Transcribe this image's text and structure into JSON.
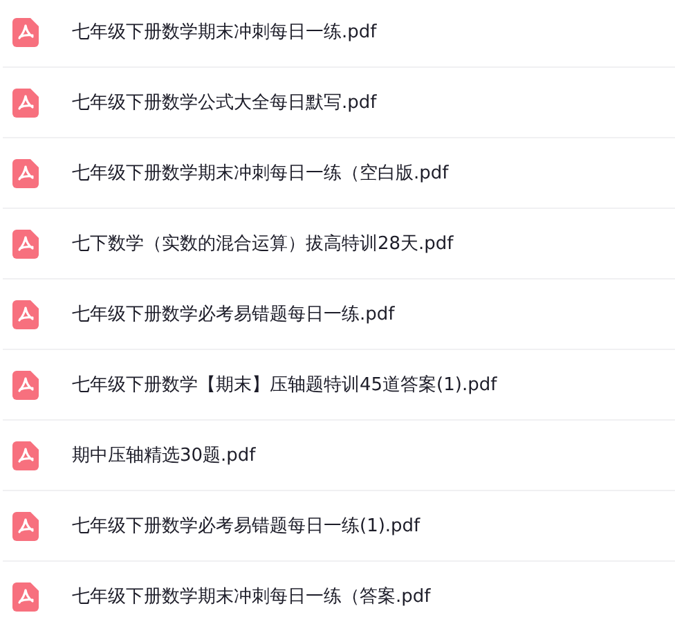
{
  "files": [
    {
      "name": "七年级下册数学期末冲刺每日一练.pdf"
    },
    {
      "name": "七年级下册数学公式大全每日默写.pdf"
    },
    {
      "name": "七年级下册数学期末冲刺每日一练（空白版.pdf"
    },
    {
      "name": "七下数学（实数的混合运算）拔高特训28天.pdf"
    },
    {
      "name": "七年级下册数学必考易错题每日一练.pdf"
    },
    {
      "name": "七年级下册数学【期末】压轴题特训45道答案(1).pdf"
    },
    {
      "name": "期中压轴精选30题.pdf"
    },
    {
      "name": "七年级下册数学必考易错题每日一练(1).pdf"
    },
    {
      "name": "七年级下册数学期末冲刺每日一练（答案.pdf"
    }
  ]
}
